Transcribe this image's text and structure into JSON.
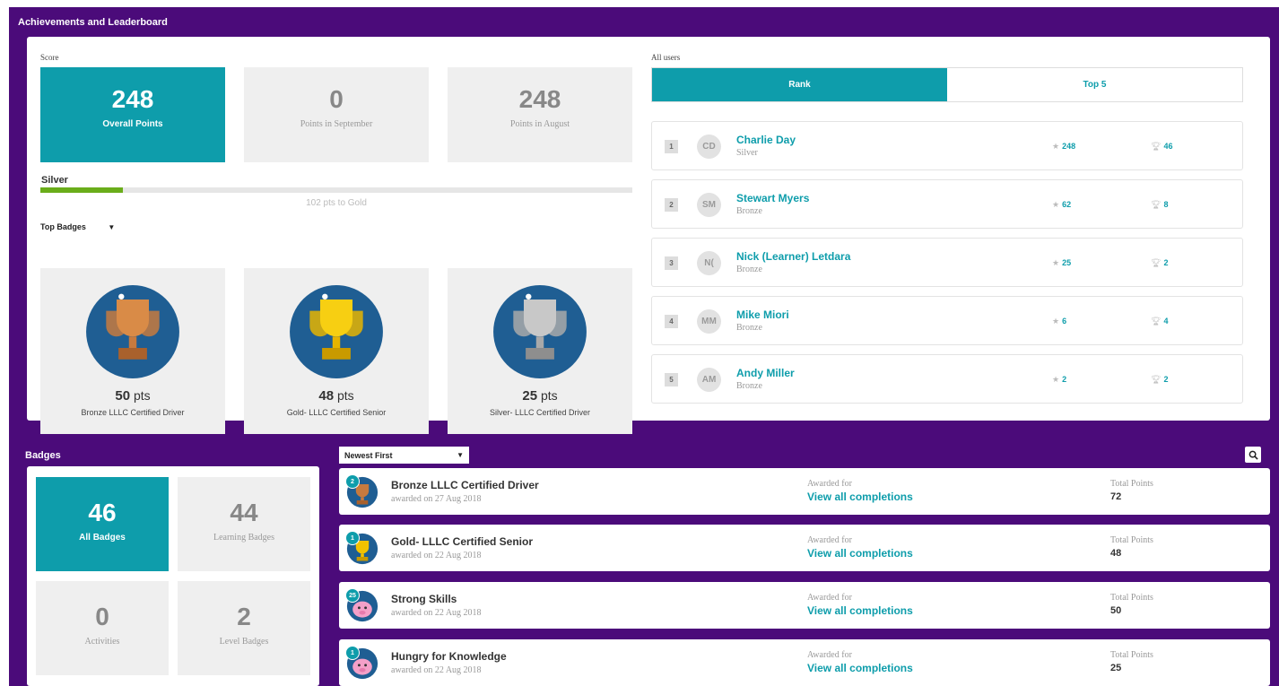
{
  "header": {
    "title": "Achievements and Leaderboard"
  },
  "score": {
    "label": "Score",
    "overall": {
      "value": "248",
      "label": "Overall Points"
    },
    "month1": {
      "value": "0",
      "label": "Points in September"
    },
    "month2": {
      "value": "248",
      "label": "Points in August"
    },
    "level": {
      "name": "Silver",
      "progress": 0.14,
      "next_text": "102 pts  to Gold",
      "bar_color": "#6aad1a"
    }
  },
  "top_badges": {
    "label": "Top Badges",
    "items": [
      {
        "pts_value": "50",
        "pts_unit": "pts",
        "name": "Bronze LLLC Certified Driver",
        "icon": "bronze-trophy-icon",
        "color": "#c77a3e"
      },
      {
        "pts_value": "48",
        "pts_unit": "pts",
        "name": "Gold- LLLC Certified Senior",
        "icon": "gold-trophy-icon",
        "color": "#f2c200"
      },
      {
        "pts_value": "25",
        "pts_unit": "pts",
        "name": "Silver- LLLC Certified Driver",
        "icon": "silver-trophy-icon",
        "color": "#b9b9b9"
      }
    ]
  },
  "leaderboard": {
    "label": "All users",
    "tabs": [
      {
        "label": "Rank",
        "active": true
      },
      {
        "label": "Top 5",
        "active": false
      }
    ],
    "rows": [
      {
        "rank": "1",
        "initials": "CD",
        "name": "Charlie Day",
        "level": "Silver",
        "points": "248",
        "badges": "46"
      },
      {
        "rank": "2",
        "initials": "SM",
        "name": "Stewart Myers",
        "level": "Bronze",
        "points": "62",
        "badges": "8"
      },
      {
        "rank": "3",
        "initials": "N(",
        "name": "Nick (Learner) Letdara",
        "level": "Bronze",
        "points": "25",
        "badges": "2"
      },
      {
        "rank": "4",
        "initials": "MM",
        "name": "Mike Miori",
        "level": "Bronze",
        "points": "6",
        "badges": "4"
      },
      {
        "rank": "5",
        "initials": "AM",
        "name": "Andy Miller",
        "level": "Bronze",
        "points": "2",
        "badges": "2"
      }
    ]
  },
  "badges": {
    "title": "Badges",
    "stats": [
      {
        "value": "46",
        "label": "All Badges",
        "active": true
      },
      {
        "value": "44",
        "label": "Learning Badges",
        "active": false
      },
      {
        "value": "0",
        "label": "Activities",
        "active": false
      },
      {
        "value": "2",
        "label": "Level Badges",
        "active": false
      }
    ],
    "sort_selected": "Newest First",
    "list": [
      {
        "count": "2",
        "title": "Bronze LLLC Certified Driver",
        "date": "awarded on 27 Aug 2018",
        "awarded_label": "Awarded for",
        "awarded_link": "View all completions",
        "total_label": "Total Points",
        "total": "72",
        "icon": "bronze-trophy-icon",
        "color": "#c77a3e"
      },
      {
        "count": "1",
        "title": "Gold- LLLC Certified Senior",
        "date": "awarded on 22 Aug 2018",
        "awarded_label": "Awarded for",
        "awarded_link": "View all completions",
        "total_label": "Total Points",
        "total": "48",
        "icon": "gold-trophy-icon",
        "color": "#f2c200"
      },
      {
        "count": "25",
        "title": "Strong Skills",
        "date": "awarded on 22 Aug 2018",
        "awarded_label": "Awarded for",
        "awarded_link": "View all completions",
        "total_label": "Total Points",
        "total": "50",
        "icon": "pig-mascot-icon",
        "color": "#f4a0c8"
      },
      {
        "count": "1",
        "title": "Hungry for Knowledge",
        "date": "awarded on 22 Aug 2018",
        "awarded_label": "Awarded for",
        "awarded_link": "View all completions",
        "total_label": "Total Points",
        "total": "25",
        "icon": "pig-mascot-icon",
        "color": "#f4a0c8"
      }
    ]
  },
  "colors": {
    "background": "#4b0b7a",
    "accent": "#0e9dab",
    "card": "#efefef"
  }
}
